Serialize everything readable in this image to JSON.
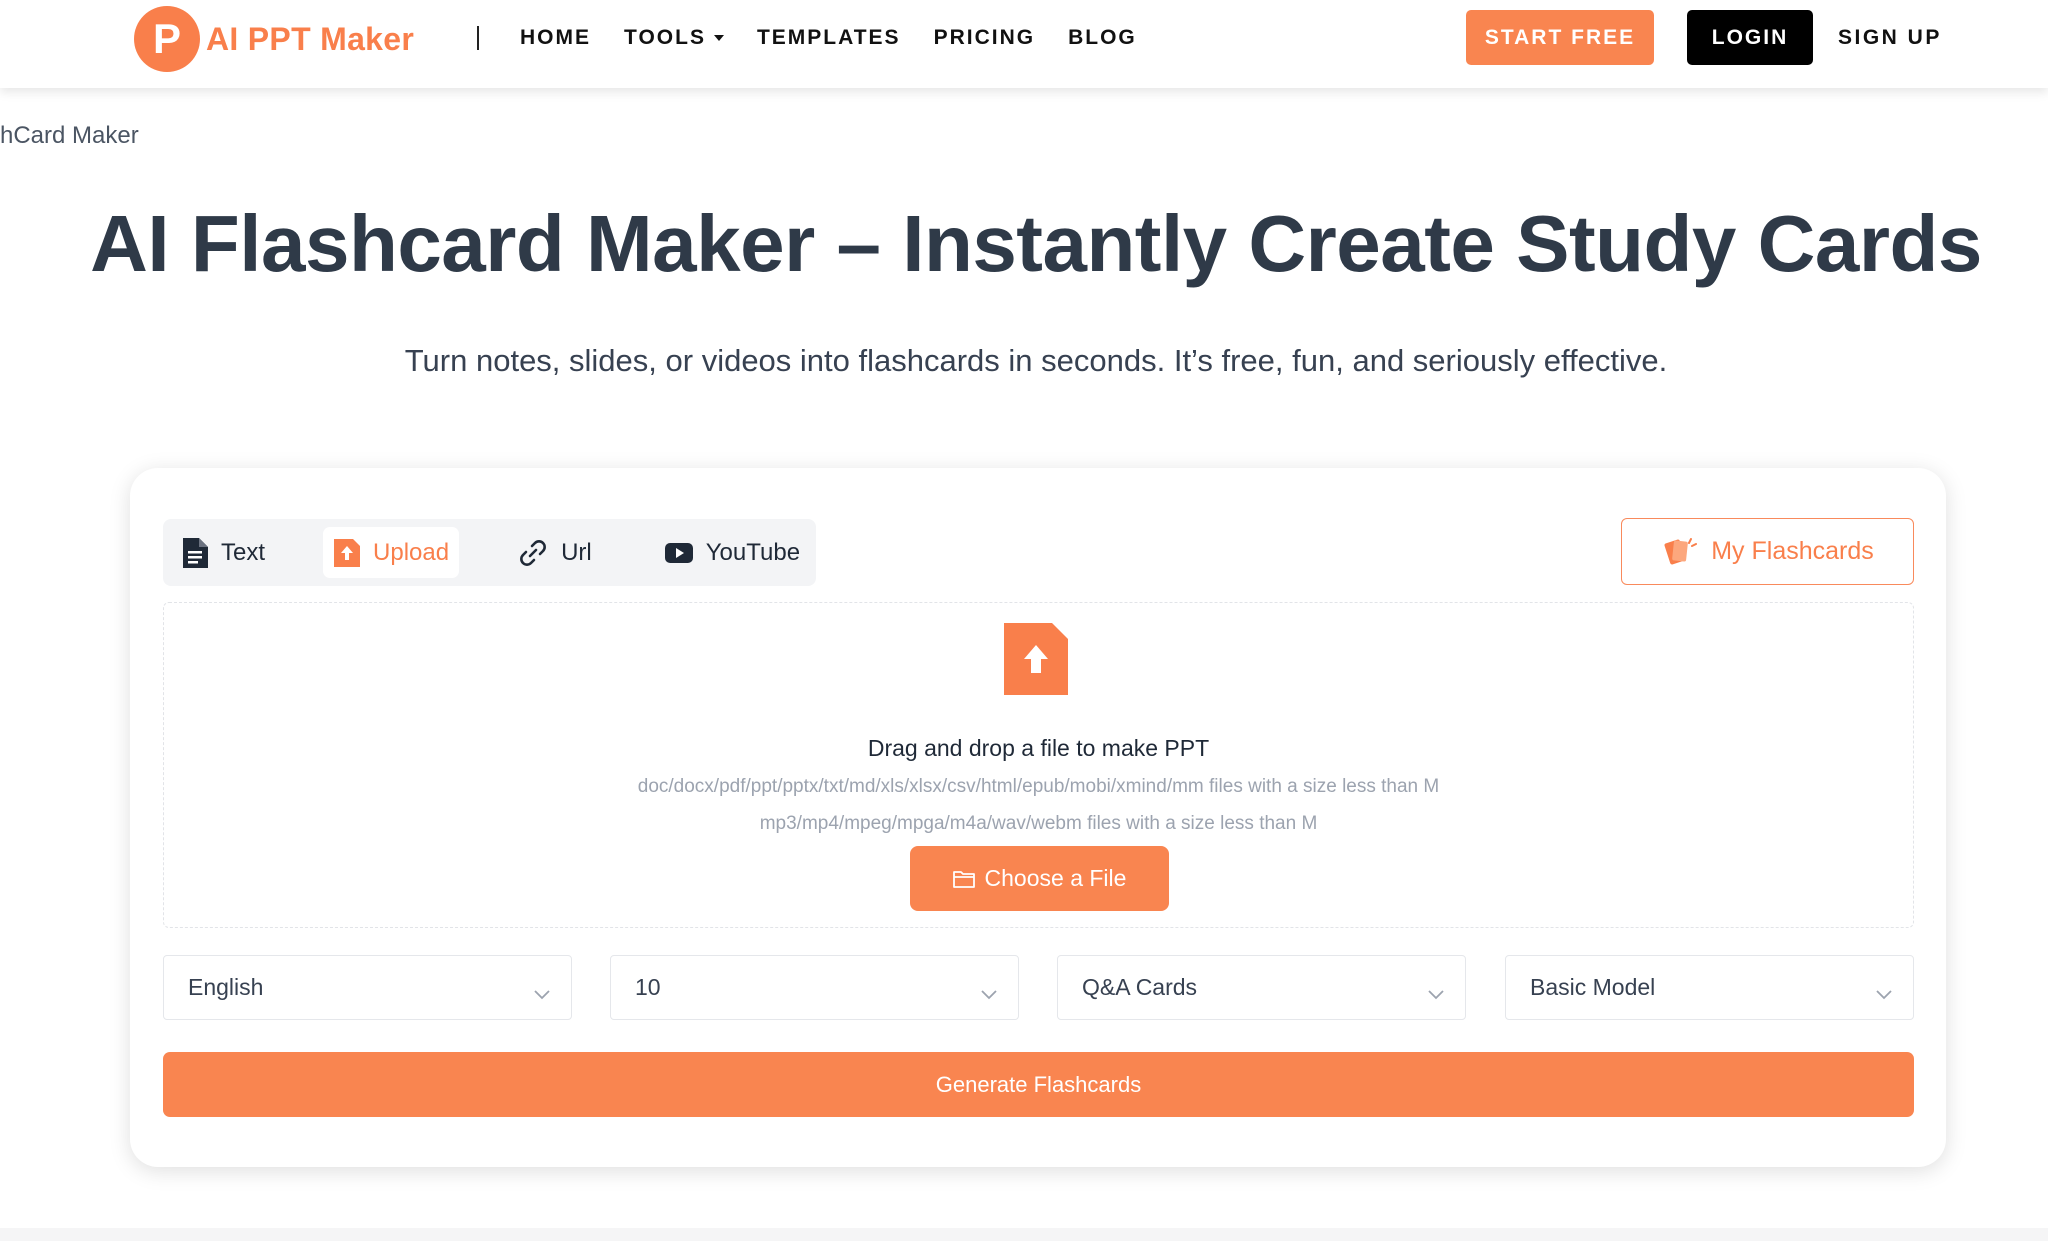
{
  "header": {
    "logo_letter": "P",
    "logo_text": "AI PPT Maker",
    "nav": [
      {
        "label": "HOME"
      },
      {
        "label": "TOOLS"
      },
      {
        "label": "TEMPLATES"
      },
      {
        "label": "PRICING"
      },
      {
        "label": "BLOG"
      }
    ],
    "start_free": "START FREE",
    "login": "LOGIN",
    "signup": "SIGN UP"
  },
  "breadcrumb": "hCard Maker",
  "hero": {
    "title": "AI Flashcard Maker – Instantly Create Study Cards",
    "subtitle": "Turn notes, slides, or videos into flashcards in seconds. It’s free, fun, and seriously effective."
  },
  "tabs": [
    {
      "label": "Text",
      "icon": "document-icon"
    },
    {
      "label": "Upload",
      "icon": "upload-file-icon",
      "active": true
    },
    {
      "label": "Url",
      "icon": "link-icon"
    },
    {
      "label": "YouTube",
      "icon": "youtube-icon"
    }
  ],
  "my_flashcards": "My Flashcards",
  "dropzone": {
    "title": "Drag and drop a file to make PPT",
    "formats_docs": "doc/docx/pdf/ppt/pptx/txt/md/xls/xlsx/csv/html/epub/mobi/xmind/mm files with a size less than M",
    "formats_media": "mp3/mp4/mpeg/mpga/m4a/wav/webm files with a size less than M",
    "choose_button": "Choose a File"
  },
  "options": {
    "language": "English",
    "count": "10",
    "card_type": "Q&A Cards",
    "model": "Basic Model"
  },
  "generate_button": "Generate Flashcards",
  "colors": {
    "accent": "#f98550",
    "title": "#2f3a48",
    "login_bg": "#000000"
  }
}
